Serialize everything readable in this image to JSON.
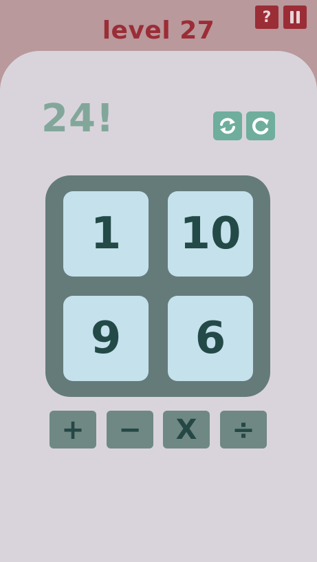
{
  "header": {
    "title": "level 27",
    "help_label": "?",
    "pause_icon": "pause-icon"
  },
  "game": {
    "target": "24!",
    "shuffle_icon": "shuffle-icon",
    "restart_icon": "restart-icon",
    "tiles": [
      "1",
      "10",
      "9",
      "6"
    ]
  },
  "operators": [
    "+",
    "−",
    "X",
    "÷"
  ],
  "colors": {
    "header_bg": "#b9999b",
    "accent_red": "#9b2d37",
    "panel_bg": "#d9d4db",
    "target_text": "#82a79a",
    "control_button": "#6fae9c",
    "board_bg": "#647b7a",
    "tile_bg": "#c4e1ec",
    "tile_text": "#244a48",
    "operator_bg": "#6f8883"
  }
}
